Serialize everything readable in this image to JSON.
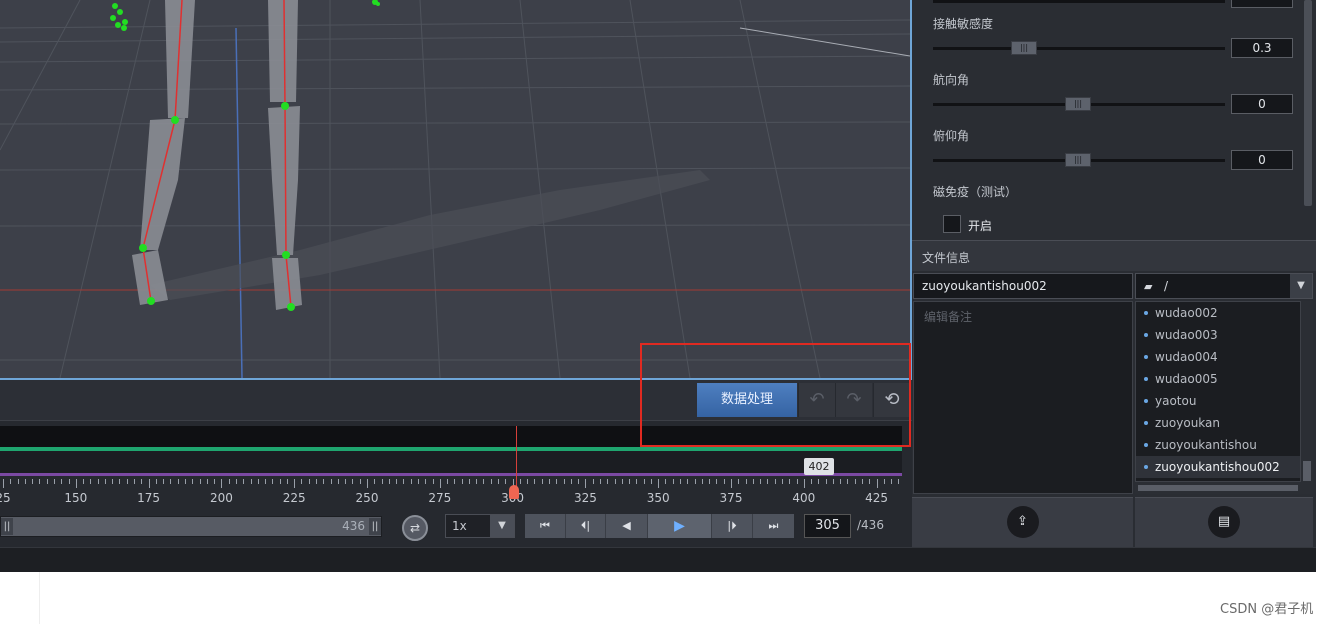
{
  "toolbar": {
    "process_button": "数据处理",
    "undo_icon": "undo-icon",
    "redo_icon": "redo-icon",
    "reset_icon": "history-reset-icon"
  },
  "timeline": {
    "marker_label": "402",
    "ruler_labels": [
      "25",
      "150",
      "175",
      "200",
      "225",
      "250",
      "275",
      "300",
      "325",
      "350",
      "375",
      "400",
      "425"
    ],
    "range_end": "436"
  },
  "controls": {
    "speed": "1x",
    "transport_icons": [
      "skip-to-start-icon",
      "step-back-icon",
      "prev-frame-icon",
      "play-icon",
      "step-forward-icon",
      "skip-to-end-icon"
    ],
    "current_frame": "305",
    "total_frames": "/436"
  },
  "settings": {
    "contact_sensitivity_label": "接触敏感度",
    "contact_sensitivity_value": "0.3",
    "heading_label": "航向角",
    "heading_value": "0",
    "pitch_label": "俯仰角",
    "pitch_value": "0",
    "magnetic_label": "磁免疫（测试）",
    "enable_label": "开启"
  },
  "file_info": {
    "header": "文件信息",
    "file_name": "zuoyoukantishou002",
    "folder": "/",
    "notes_placeholder": "编辑备注",
    "files": [
      "wudao002",
      "wudao003",
      "wudao004",
      "wudao005",
      "yaotou",
      "zuoyoukan",
      "zuoyoukantishou",
      "zuoyoukantishou002"
    ],
    "selected_file": "zuoyoukantishou002",
    "upload_icon": "upload-icon",
    "document_icon": "document-list-icon"
  },
  "watermark": "CSDN @君子机",
  "colors": {
    "accent_blue": "#3f70b3",
    "highlight_red": "#e02a21",
    "track_green": "#1fa56f",
    "track_purple": "#7b49a3",
    "bone_red": "#e03030",
    "joint_green": "#22dd22"
  }
}
